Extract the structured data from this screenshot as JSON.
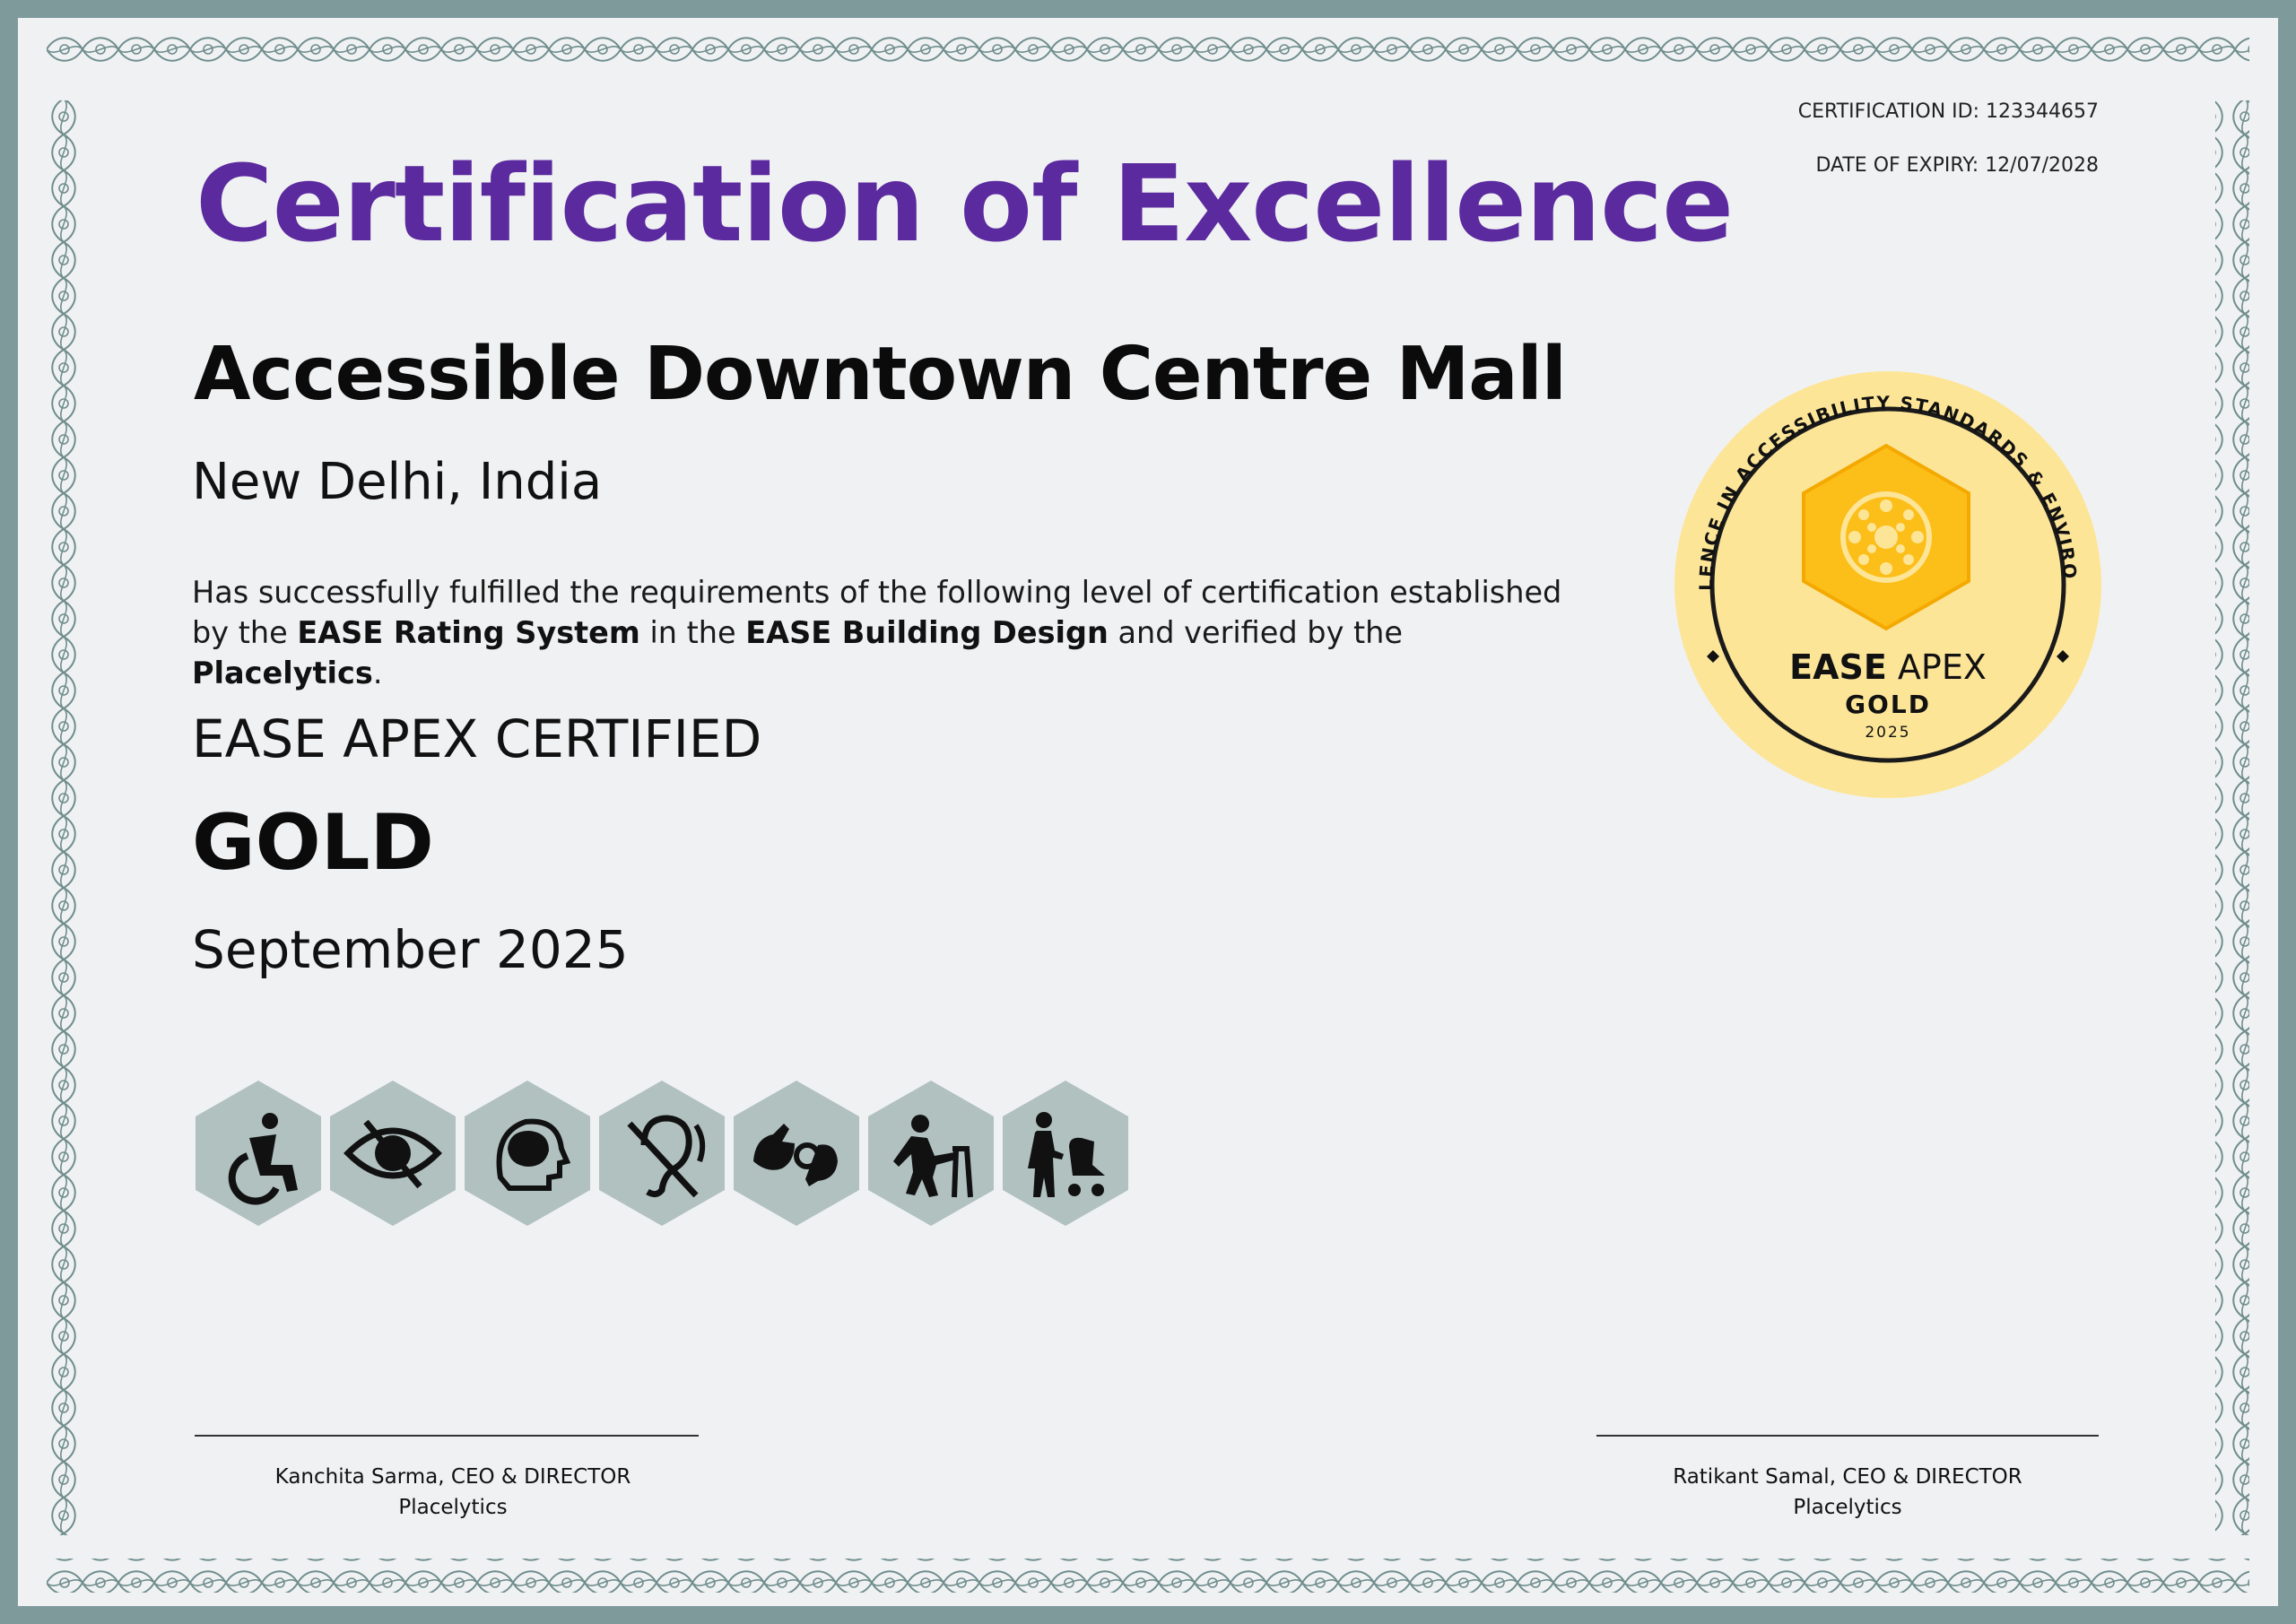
{
  "certificate": {
    "certification_id": "CERTIFICATION ID: 123344657",
    "date_of_expiry": "DATE OF EXPIRY: 12/07/2028",
    "title": "Certification of Excellence",
    "building_name": "Accessible Downtown Centre Mall",
    "location": "New Delhi, India",
    "statement": {
      "part1": "Has successfully fulfilled the requirements of the following level of certification established by the ",
      "rating_system": "EASE Rating System",
      "part2": " in the ",
      "building_design": "EASE Building Design",
      "part3": " and verified by the ",
      "verifier": "Placelytics",
      "part4": "."
    },
    "certified_label": "EASE APEX CERTIFIED",
    "level": "GOLD",
    "issue_date": "September 2025"
  },
  "seal": {
    "ring_text": "EXCELLENCE IN ACCESSIBILITY STANDARDS & ENVIRONMENT",
    "name_bold": "EASE",
    "name_regular": " APEX",
    "level": "GOLD",
    "year": "2025",
    "colors": {
      "outer": "#fde598",
      "hexagon": "#fcbe18",
      "ring": "#1a1a1a"
    }
  },
  "accessibility_icons": [
    "wheelchair-icon",
    "visual-impairment-icon",
    "cognitive-icon",
    "hearing-impairment-icon",
    "sign-language-icon",
    "walker-icon",
    "stroller-icon"
  ],
  "signatories": [
    {
      "name": "Kanchita Sarma, CEO & DIRECTOR",
      "org": "Placelytics"
    },
    {
      "name": "Ratikant Samal, CEO & DIRECTOR",
      "org": "Placelytics"
    }
  ],
  "colors": {
    "title": "#5b2a9e",
    "frame": "#7f9a9b",
    "paper": "#f0f1f3",
    "icon_hex": "#b0c1c0"
  }
}
